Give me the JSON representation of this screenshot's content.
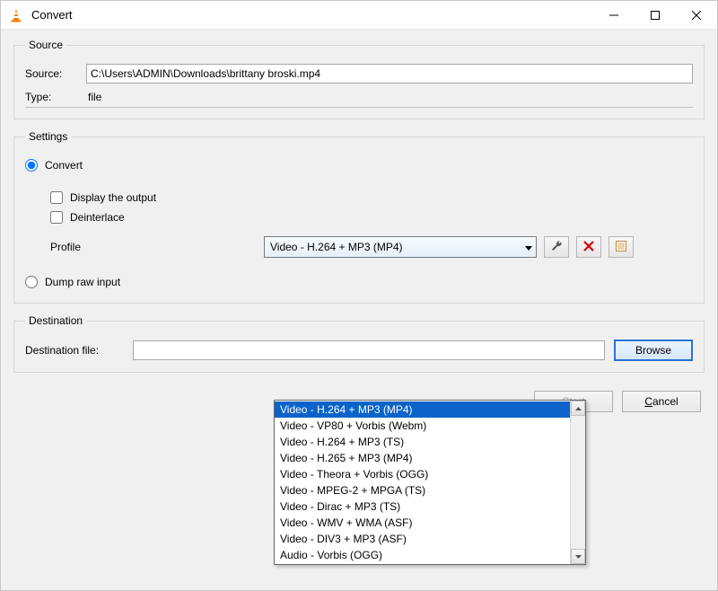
{
  "window": {
    "title": "Convert"
  },
  "source_group": {
    "legend": "Source",
    "source_label": "Source:",
    "source_value": "C:\\Users\\ADMIN\\Downloads\\brittany broski.mp4",
    "type_label": "Type:",
    "type_value": "file"
  },
  "settings_group": {
    "legend": "Settings",
    "convert_label": "Convert",
    "display_output_label": "Display the output",
    "deinterlace_label": "Deinterlace",
    "profile_label": "Profile",
    "profile_value": "Video - H.264 + MP3 (MP4)",
    "profile_options": [
      "Video - H.264 + MP3 (MP4)",
      "Video - VP80 + Vorbis (Webm)",
      "Video - H.264 + MP3 (TS)",
      "Video - H.265 + MP3 (MP4)",
      "Video - Theora + Vorbis (OGG)",
      "Video - MPEG-2 + MPGA (TS)",
      "Video - Dirac + MP3 (TS)",
      "Video - WMV + WMA (ASF)",
      "Video - DIV3 + MP3 (ASF)",
      "Audio - Vorbis (OGG)"
    ],
    "profile_selected_index": 0,
    "tool_buttons": {
      "edit": "wrench-icon",
      "delete": "delete-icon",
      "new": "new-profile-icon"
    },
    "dump_label": "Dump raw input"
  },
  "destination_group": {
    "legend": "Destination",
    "dest_label": "Destination file:",
    "dest_value": "",
    "browse_label": "Browse"
  },
  "buttons": {
    "start": "Start",
    "cancel": "Cancel"
  }
}
